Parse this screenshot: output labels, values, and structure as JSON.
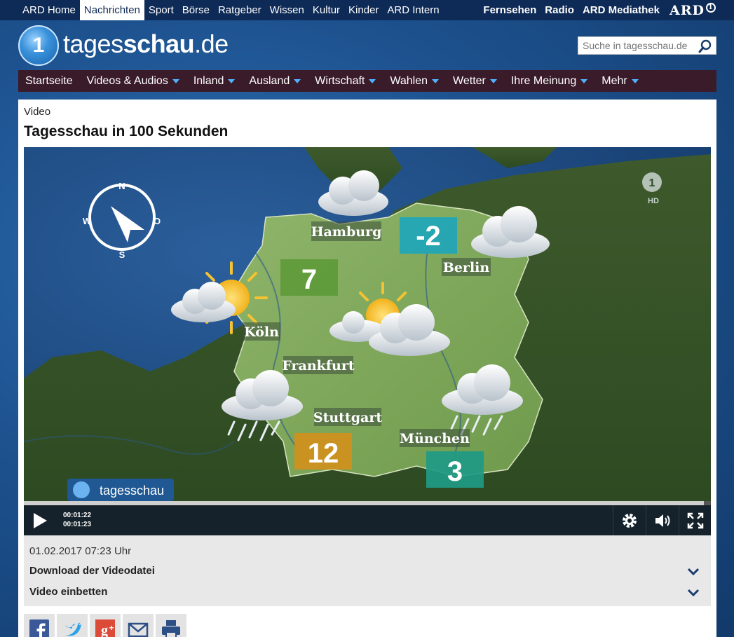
{
  "ard_nav": {
    "left_items": [
      "ARD Home",
      "Nachrichten",
      "Sport",
      "Börse",
      "Ratgeber",
      "Wissen",
      "Kultur",
      "Kinder",
      "ARD Intern"
    ],
    "active": "Nachrichten",
    "right_items": [
      "Fernsehen",
      "Radio",
      "ARD Mediathek"
    ],
    "brand": "ARD",
    "brand_badge": "1"
  },
  "site": {
    "logo_prefix": "tages",
    "logo_bold": "schau",
    "logo_suffix": ".de",
    "logo_badge": "1"
  },
  "search": {
    "placeholder": "Suche in tagesschau.de"
  },
  "main_nav": [
    {
      "label": "Startseite",
      "has_menu": false
    },
    {
      "label": "Videos & Audios",
      "has_menu": true
    },
    {
      "label": "Inland",
      "has_menu": true
    },
    {
      "label": "Ausland",
      "has_menu": true
    },
    {
      "label": "Wirtschaft",
      "has_menu": true
    },
    {
      "label": "Wahlen",
      "has_menu": true
    },
    {
      "label": "Wetter",
      "has_menu": true
    },
    {
      "label": "Ihre Meinung",
      "has_menu": true
    },
    {
      "label": "Mehr",
      "has_menu": true
    }
  ],
  "page": {
    "kicker": "Video",
    "title": "Tagesschau in 100 Sekunden"
  },
  "video": {
    "channel_logo": "tagesschau",
    "hd_label": "HD",
    "hd_badge": "1",
    "compass": {
      "n": "N",
      "s": "S",
      "w": "W",
      "o": "O"
    },
    "cities": [
      "Hamburg",
      "Berlin",
      "Köln",
      "Frankfurt",
      "Stuttgart",
      "München"
    ],
    "temperatures": [
      {
        "value": "-2",
        "color": "#1fa6b8"
      },
      {
        "value": "7",
        "color": "#5e9a3a"
      },
      {
        "value": "12",
        "color": "#d0901c"
      },
      {
        "value": "3",
        "color": "#1f9a85"
      }
    ],
    "time_current": "00:01:22",
    "time_total": "00:01:23",
    "progress": 0.99
  },
  "meta": {
    "date": "01.02.2017 07:23 Uhr",
    "download_label": "Download der Videodatei",
    "embed_label": "Video einbetten"
  },
  "share_buttons": [
    "facebook-icon",
    "twitter-icon",
    "google-plus-icon",
    "mail-icon",
    "print-icon"
  ],
  "colors": {
    "top_bar": "#0e2a56",
    "main_nav": "#3a1b2a",
    "nav_caret": "#4fb2ff",
    "facebook": "#3b5998",
    "twitter": "#2aa3e8",
    "google_plus": "#dc4a38",
    "mail": "#2c4f86",
    "print": "#2c4f86"
  }
}
